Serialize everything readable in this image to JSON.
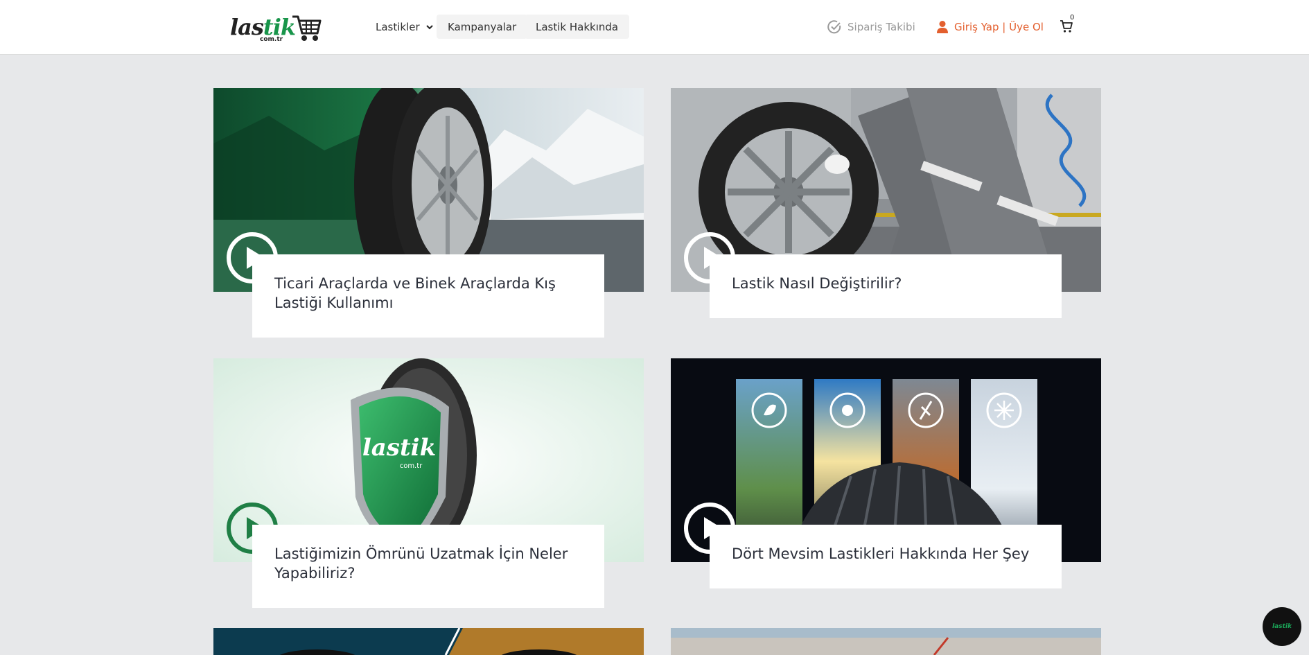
{
  "header": {
    "logo": {
      "brand_dark": "las",
      "brand_green": "tik",
      "sub": "com.tr"
    },
    "nav": [
      {
        "label": "Lastikler",
        "has_dropdown": true
      },
      {
        "label": "Kampanyalar"
      },
      {
        "label": "Lastik Hakkında"
      }
    ],
    "order_tracking": {
      "label": "Sipariş Takibi",
      "icon": "check-circle-icon"
    },
    "login": {
      "label": "Giriş Yap | Üye Ol",
      "icon": "user-icon"
    },
    "cart": {
      "count": "0",
      "icon": "cart-icon"
    }
  },
  "articles": [
    {
      "title": "Ticari Araçlarda ve Binek Araçlarda Kış Lastiği Kullanımı",
      "image": "winter-tire-mountain"
    },
    {
      "title": "Lastik Nasıl Değiştirilir?",
      "image": "mechanic-changing-tire"
    },
    {
      "title": "Lastiğimizin Ömrünü Uzatmak İçin Neler Yapabiliriz?",
      "image": "tire-shield-logo"
    },
    {
      "title": "Dört Mevsim Lastikleri Hakkında Her Şey",
      "image": "four-seasons-tire"
    }
  ],
  "chat": {
    "label": "lastik"
  },
  "colors": {
    "brand_green": "#18954a",
    "accent_orange": "#e35f2e",
    "page_bg": "#e7e8ea"
  }
}
